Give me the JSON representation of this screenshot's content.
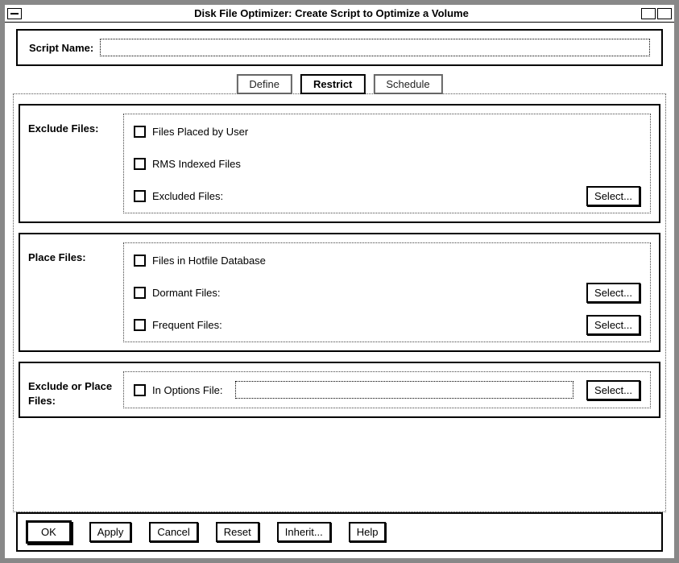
{
  "window": {
    "title": "Disk File Optimizer: Create Script to Optimize a Volume"
  },
  "scriptName": {
    "label": "Script Name:",
    "value": ""
  },
  "tabs": {
    "define": "Define",
    "restrict": "Restrict",
    "schedule": "Schedule",
    "active": "Restrict"
  },
  "groups": {
    "exclude": {
      "title": "Exclude Files:",
      "items": {
        "placedByUser": "Files Placed by User",
        "rmsIndexed": "RMS Indexed Files",
        "excludedFiles": "Excluded Files:"
      }
    },
    "place": {
      "title": "Place Files:",
      "items": {
        "hotfile": "Files in Hotfile Database",
        "dormant": "Dormant Files:",
        "frequent": "Frequent Files:"
      }
    },
    "options": {
      "title": "Exclude or Place Files:",
      "items": {
        "inOptionsFile": "In Options File:"
      },
      "optionsFileValue": ""
    }
  },
  "buttons": {
    "select": "Select...",
    "ok": "OK",
    "apply": "Apply",
    "cancel": "Cancel",
    "reset": "Reset",
    "inherit": "Inherit...",
    "help": "Help"
  }
}
